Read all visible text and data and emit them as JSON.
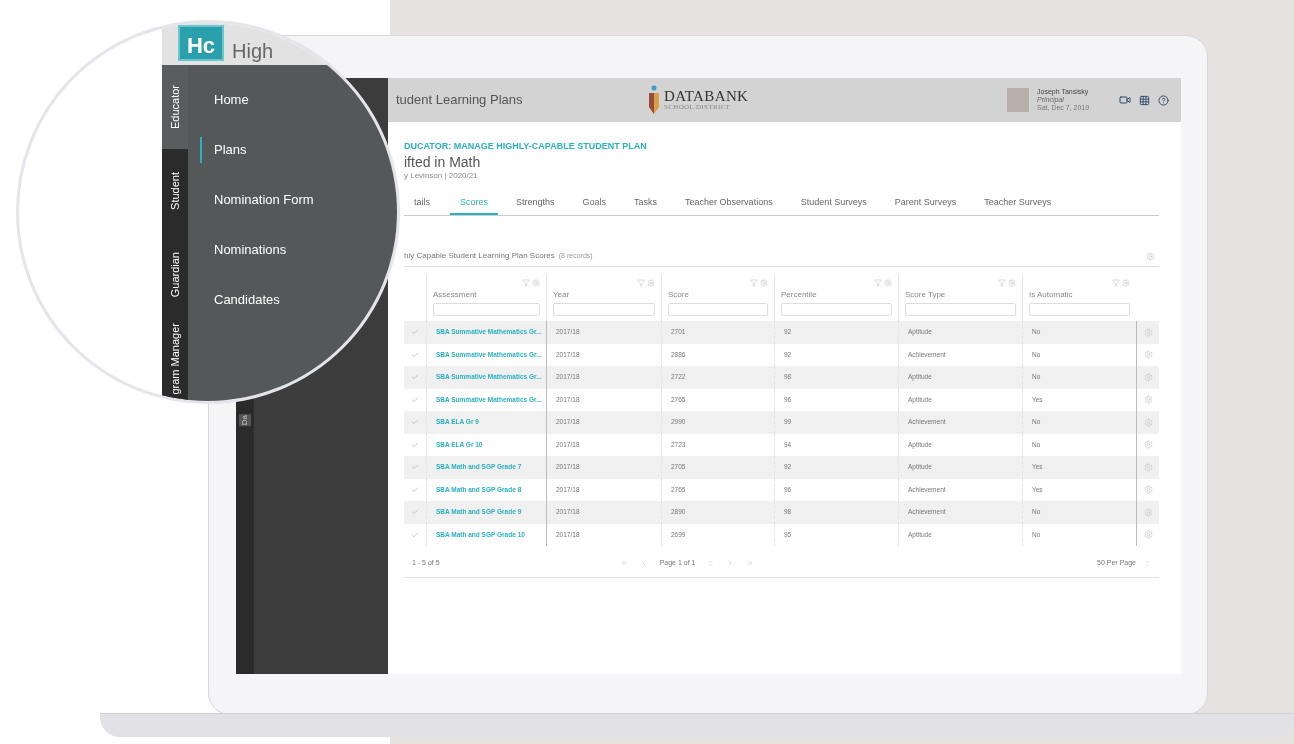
{
  "app": {
    "logo": "Hc",
    "name": "High"
  },
  "role_tabs": [
    {
      "label": "Educator",
      "selected": true
    },
    {
      "label": "Student",
      "selected": false
    },
    {
      "label": "Guardian",
      "selected": false
    },
    {
      "label": "gram Manager",
      "selected": false
    }
  ],
  "nav": [
    {
      "label": "Home",
      "selected": false
    },
    {
      "label": "Plans",
      "selected": true
    },
    {
      "label": "Nomination Form",
      "selected": false
    },
    {
      "label": "Nominations",
      "selected": false
    },
    {
      "label": "Candidates",
      "selected": false
    }
  ],
  "collapsed_sidebar": {
    "label": "Da"
  },
  "header": {
    "title": "tudent Learning Plans",
    "logo": {
      "name": "DATABANK",
      "subtitle": "SCHOOL DISTRICT"
    },
    "user": {
      "name": "Joseph Tansisky",
      "role": "Principal",
      "date": "Sat, Dec 7, 2019"
    }
  },
  "page": {
    "breadcrumb": "DUCATOR: MANAGE HIGHLY-CAPABLE STUDENT PLAN",
    "title": "ifted in Math",
    "subtitle": "y Levinson | 2020/21"
  },
  "tabs": [
    {
      "label": "tails",
      "selected": false
    },
    {
      "label": "Scores",
      "selected": true
    },
    {
      "label": "Strengths",
      "selected": false
    },
    {
      "label": "Goals",
      "selected": false
    },
    {
      "label": "Tasks",
      "selected": false
    },
    {
      "label": "Teacher Observations",
      "selected": false
    },
    {
      "label": "Student Surveys",
      "selected": false
    },
    {
      "label": "Parent Surveys",
      "selected": false
    },
    {
      "label": "Teacher Surveys",
      "selected": false
    }
  ],
  "table": {
    "title": "hly Capable Student Learning Plan Scores",
    "count": "(8 records)",
    "columns": [
      "Assessment",
      "Year",
      "Score",
      "Percentile",
      "Score Type",
      "Is Automatic"
    ],
    "rows": [
      [
        "SBA Summative Mathematics Gr...",
        "2017/18",
        "2701",
        "92",
        "Aptitude",
        "No"
      ],
      [
        "SBA Summative Mathematics Gr...",
        "2017/18",
        "2886",
        "92",
        "Achievement",
        "No"
      ],
      [
        "SBA Summative Mathematics Gr...",
        "2017/18",
        "2722",
        "98",
        "Aptitude",
        "No"
      ],
      [
        "SBA Summative Mathematics Gr...",
        "2017/18",
        "2765",
        "96",
        "Aptitude",
        "Yes"
      ],
      [
        "SBA ELA Gr 9",
        "2017/18",
        "2990",
        "99",
        "Achievement",
        "No"
      ],
      [
        "SBA ELA Gr 10",
        "2017/18",
        "2723",
        "94",
        "Aptitude",
        "No"
      ],
      [
        "SBA Math and SGP Grade 7",
        "2017/18",
        "2705",
        "92",
        "Aptitude",
        "Yes"
      ],
      [
        "SBA Math and SGP Grade 8",
        "2017/18",
        "2765",
        "96",
        "Achievement",
        "Yes"
      ],
      [
        "SBA Math and SGP Grade 9",
        "2017/18",
        "2890",
        "98",
        "Achievement",
        "No"
      ],
      [
        "SBA Math and SGP Grade 10",
        "2017/18",
        "2699",
        "95",
        "Aptitude",
        "No"
      ]
    ]
  },
  "footer": {
    "range": "1 - 5 of 5",
    "page": "Page 1 of 1",
    "per_page": "50 Per Page"
  }
}
